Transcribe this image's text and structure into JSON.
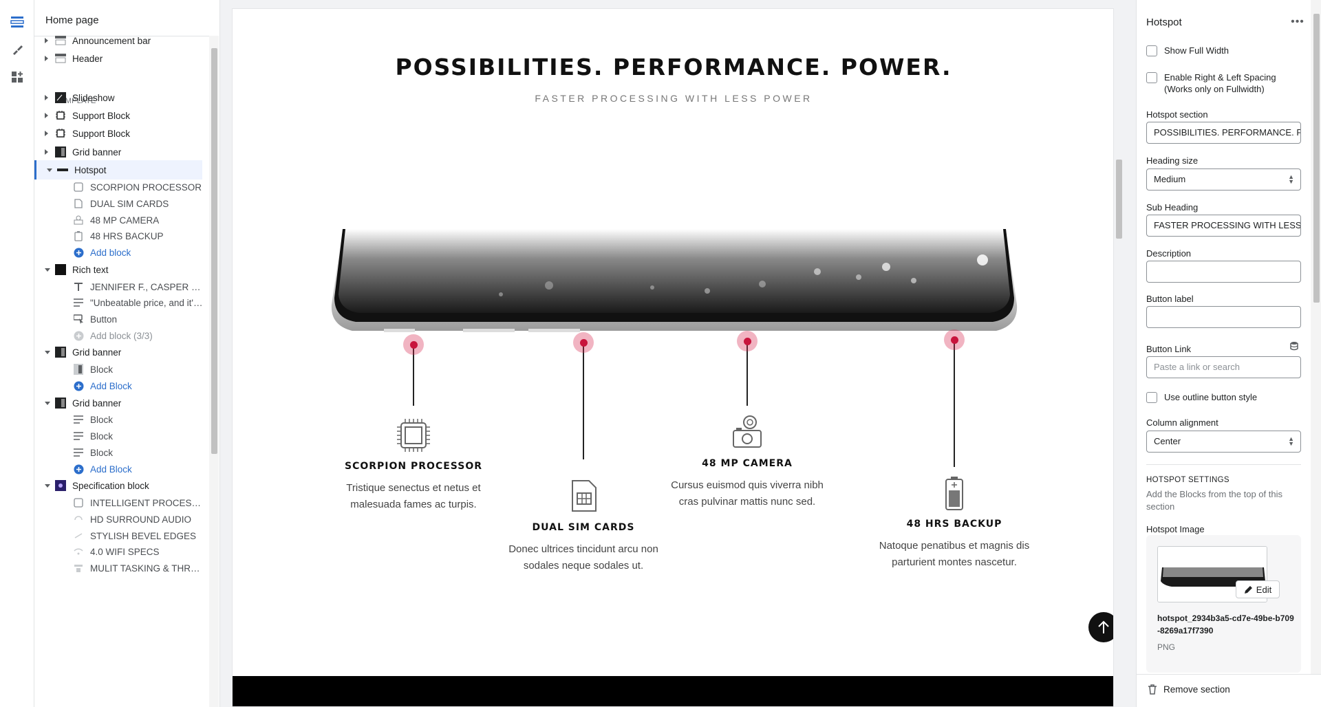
{
  "rail": {
    "icons": [
      "sections-icon",
      "theme-settings-icon",
      "app-blocks-icon"
    ]
  },
  "nav": {
    "title": "Home page",
    "template_label": "TEMPLATE",
    "rows": [
      {
        "label": "Announcement bar",
        "level": 0,
        "caret": "right",
        "icon": "announcement-bar-icon"
      },
      {
        "label": "Header",
        "level": 0,
        "caret": "right",
        "icon": "header-icon"
      },
      {
        "label": "Slideshow",
        "level": 0,
        "caret": "right",
        "icon": "slideshow-icon"
      },
      {
        "label": "Support Block",
        "level": 0,
        "caret": "right",
        "icon": "support-block-icon"
      },
      {
        "label": "Support Block",
        "level": 0,
        "caret": "right",
        "icon": "support-block-icon"
      },
      {
        "label": "Grid banner",
        "level": 0,
        "caret": "right",
        "icon": "grid-banner-icon"
      },
      {
        "label": "Hotspot",
        "level": 0,
        "caret": "down",
        "icon": "hotspot-icon",
        "selected": true
      },
      {
        "label": "SCORPION PROCESSOR",
        "level": 1,
        "icon": "processor-icon"
      },
      {
        "label": "DUAL SIM CARDS",
        "level": 1,
        "icon": "sim-card-icon"
      },
      {
        "label": "48 MP CAMERA",
        "level": 1,
        "icon": "camera-icon"
      },
      {
        "label": "48 HRS BACKUP",
        "level": 1,
        "icon": "battery-icon"
      },
      {
        "label": "Add block",
        "level": 1,
        "kind": "add"
      },
      {
        "label": "Rich text",
        "level": 0,
        "caret": "down",
        "icon": "rich-text-icon"
      },
      {
        "label": "JENNIFER F., CASPER CUST...",
        "level": 1,
        "icon": "text-icon"
      },
      {
        "label": "\"Unbeatable price, and it's ...",
        "level": 1,
        "icon": "paragraph-icon"
      },
      {
        "label": "Button",
        "level": 1,
        "icon": "button-icon"
      },
      {
        "label": "Add block (3/3)",
        "level": 1,
        "kind": "disabled"
      },
      {
        "label": "Grid banner",
        "level": 0,
        "caret": "down",
        "icon": "grid-banner-icon"
      },
      {
        "label": "Block",
        "level": 1,
        "icon": "block-image-icon"
      },
      {
        "label": "Add Block",
        "level": 1,
        "kind": "add"
      },
      {
        "label": "Grid banner",
        "level": 0,
        "caret": "down",
        "icon": "grid-banner-icon"
      },
      {
        "label": "Block",
        "level": 1,
        "icon": "paragraph-icon"
      },
      {
        "label": "Block",
        "level": 1,
        "icon": "paragraph-icon"
      },
      {
        "label": "Block",
        "level": 1,
        "icon": "paragraph-icon"
      },
      {
        "label": "Add Block",
        "level": 1,
        "kind": "add"
      },
      {
        "label": "Specification block",
        "level": 0,
        "caret": "down",
        "icon": "specification-icon"
      },
      {
        "label": "INTELLIGENT PROCESSOR",
        "level": 1,
        "icon": "processor-icon"
      },
      {
        "label": "HD SURROUND AUDIO",
        "level": 1,
        "icon": "audio-icon"
      },
      {
        "label": "STYLISH BEVEL EDGES",
        "level": 1,
        "icon": "bevel-icon"
      },
      {
        "label": "4.0 WIFI SPECS",
        "level": 1,
        "icon": "wifi-icon"
      },
      {
        "label": "MULIT TASKING & THREAD...",
        "level": 1,
        "icon": "multitask-icon"
      }
    ]
  },
  "preview": {
    "title": "POSSIBILITIES. PERFORMANCE. POWER.",
    "subtitle": "FASTER PROCESSING WITH LESS POWER",
    "features": [
      {
        "title": "SCORPION PROCESSOR",
        "desc1": "Tristique senectus et netus et",
        "desc2": "malesuada fames ac turpis.",
        "icon": "processor-icon"
      },
      {
        "title": "DUAL SIM CARDS",
        "desc1": "Donec ultrices tincidunt arcu non",
        "desc2": "sodales neque sodales ut.",
        "icon": "sim-card-icon"
      },
      {
        "title": "48 MP CAMERA",
        "desc1": "Cursus euismod quis viverra nibh",
        "desc2": "cras pulvinar mattis nunc sed.",
        "icon": "camera-icon"
      },
      {
        "title": "48 HRS BACKUP",
        "desc1": "Natoque penatibus et magnis dis",
        "desc2": "parturient montes nascetur.",
        "icon": "battery-icon"
      }
    ],
    "back_to_top_icon": "arrow-up-icon"
  },
  "settings": {
    "title": "Hotspot",
    "show_full_width": "Show Full Width",
    "enable_spacing": "Enable Right & Left Spacing (Works only on Fullwidth)",
    "hotspot_section_label": "Hotspot section",
    "hotspot_section_value": "POSSIBILITIES. PERFORMANCE. POWER.",
    "heading_size_label": "Heading size",
    "heading_size_value": "Medium",
    "sub_heading_label": "Sub Heading",
    "sub_heading_value": "FASTER PROCESSING WITH LESS POWER",
    "description_label": "Description",
    "button_label_label": "Button label",
    "button_link_label": "Button Link",
    "button_link_placeholder": "Paste a link or search",
    "outline_label": "Use outline button style",
    "column_alignment_label": "Column alignment",
    "column_alignment_value": "Center",
    "hotspot_settings_heading": "HOTSPOT SETTINGS",
    "hotspot_settings_desc": "Add the Blocks from the top of this section",
    "hotspot_image_label": "Hotspot Image",
    "edit_label": "Edit",
    "image_name": "hotspot_2934b3a5-cd7e-49be-b709-8269a17f7390",
    "image_type": "PNG",
    "remove_section": "Remove section"
  },
  "colors": {
    "accent": "#2c6ecb",
    "pin": "#c8143c",
    "selected_bg": "#eef3fe"
  }
}
